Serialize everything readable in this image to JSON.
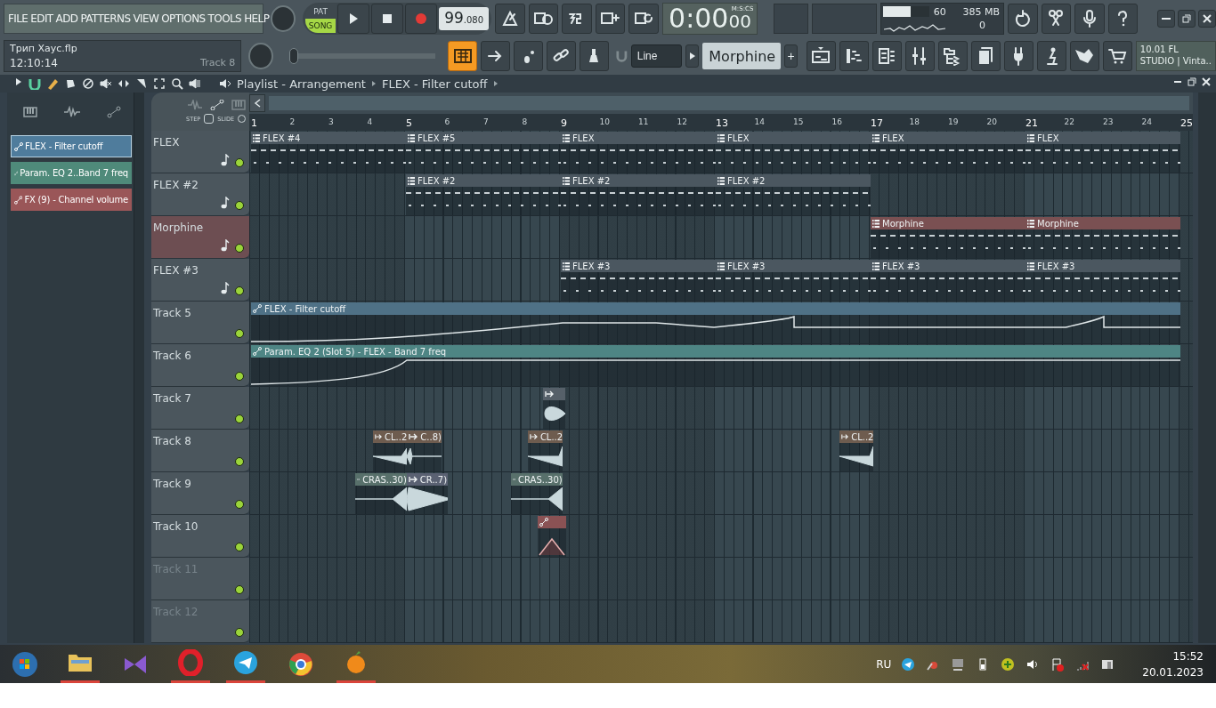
{
  "menu": [
    "FILE",
    "EDIT",
    "ADD",
    "PATTERNS",
    "VIEW",
    "OPTIONS",
    "TOOLS",
    "HELP"
  ],
  "song_info": {
    "file": "Трип Хаус.flp",
    "time": "12:10:14",
    "track": "Track 8"
  },
  "mode": [
    {
      "label": "PAT",
      "selected": false
    },
    {
      "label": "SONG",
      "selected": true
    }
  ],
  "tempo": {
    "whole": "99",
    "fraction": ".080"
  },
  "clock": {
    "value": "0:00",
    "hundredths": "00",
    "unit": "M:S:CS"
  },
  "monitor": {
    "cpu": "60",
    "level": 0.6,
    "memory": "385 MB",
    "polyphony": "0"
  },
  "song_position": {
    "level": 0
  },
  "snap": {
    "value": "Line"
  },
  "pattern": {
    "value": "Morphine",
    "add": "+"
  },
  "news": [
    "10.01  FL",
    "STUDIO | Vinta.."
  ],
  "playlist": {
    "title": "Playlist - Arrangement",
    "breadcrumb": "FLEX - Filter cutoff",
    "step": "STEP",
    "slide": "SLIDE"
  },
  "clip_sources": [
    {
      "label": "FLEX - Filter cutoff",
      "color": "#4f7c9c",
      "selected": true
    },
    {
      "label": "Param. EQ 2..Band 7 freq",
      "color": "#4f8a7a",
      "selected": false
    },
    {
      "label": "FX (9) - Channel volume",
      "color": "#9a5658",
      "selected": false
    }
  ],
  "bars": [
    "1",
    "2",
    "3",
    "4",
    "5",
    "6",
    "7",
    "8",
    "9",
    "10",
    "11",
    "12",
    "13",
    "14",
    "15",
    "16",
    "17",
    "18",
    "19",
    "20",
    "21",
    "22",
    "23",
    "24",
    "25"
  ],
  "tracks": [
    {
      "name": "FLEX",
      "kind": "instrument",
      "selected": false,
      "empty": false,
      "muted": false,
      "clips": [
        {
          "label": "FLEX #4",
          "kind": "pattern",
          "color": "#4b5760"
        },
        {
          "label": "FLEX #5",
          "kind": "pattern",
          "color": "#4b5760"
        },
        {
          "label": "FLEX",
          "kind": "pattern",
          "color": "#4b5760"
        },
        {
          "label": "FLEX",
          "kind": "pattern",
          "color": "#4b5760"
        },
        {
          "label": "FLEX",
          "kind": "pattern",
          "color": "#4b5760"
        },
        {
          "label": "FLEX",
          "kind": "pattern",
          "color": "#4b5760"
        }
      ]
    },
    {
      "name": "FLEX #2",
      "kind": "instrument",
      "selected": false,
      "empty": false,
      "muted": false,
      "clips": [
        {
          "label": "FLEX #2",
          "kind": "pattern",
          "color": "#4b5760"
        },
        {
          "label": "FLEX #2",
          "kind": "pattern",
          "color": "#4b5760"
        },
        {
          "label": "FLEX #2",
          "kind": "pattern",
          "color": "#4b5760"
        }
      ]
    },
    {
      "name": "Morphine",
      "kind": "instrument",
      "selected": true,
      "empty": false,
      "muted": false,
      "clips": [
        {
          "label": "Morphine",
          "kind": "pattern",
          "color": "#7a5052"
        },
        {
          "label": "Morphine",
          "kind": "pattern",
          "color": "#7a5052"
        }
      ]
    },
    {
      "name": "FLEX #3",
      "kind": "instrument",
      "selected": false,
      "empty": false,
      "muted": false,
      "clips": [
        {
          "label": "FLEX #3",
          "kind": "pattern",
          "color": "#4b5760"
        },
        {
          "label": "FLEX #3",
          "kind": "pattern",
          "color": "#4b5760"
        },
        {
          "label": "FLEX #3",
          "kind": "pattern",
          "color": "#4b5760"
        },
        {
          "label": "FLEX #3",
          "kind": "pattern",
          "color": "#4b5760"
        }
      ]
    },
    {
      "name": "Track 5",
      "kind": "plain",
      "selected": false,
      "empty": false,
      "muted": false,
      "clips": [
        {
          "label": "FLEX - Filter cutoff",
          "kind": "automation",
          "color": "#4f7186"
        }
      ]
    },
    {
      "name": "Track 6",
      "kind": "plain",
      "selected": false,
      "empty": false,
      "muted": false,
      "clips": [
        {
          "label": "Param. EQ 2 (Slot 5) - FLEX - Band 7 freq",
          "kind": "automation",
          "color": "#4e8584"
        }
      ]
    },
    {
      "name": "Track 7",
      "kind": "plain",
      "selected": false,
      "empty": false,
      "muted": false,
      "clips": [
        {
          "kind": "audio",
          "color": "#566069"
        }
      ]
    },
    {
      "name": "Track 8",
      "kind": "plain",
      "selected": false,
      "empty": false,
      "muted": false,
      "clips": [
        {
          "label": "CL..2",
          "kind": "audio",
          "color": "#6e5c4f"
        },
        {
          "label": "C..8)",
          "kind": "audio",
          "color": "#6e5c4f"
        },
        {
          "label": "CL..2",
          "kind": "audio",
          "color": "#6e5c4f"
        },
        {
          "label": "CL..2",
          "kind": "audio",
          "color": "#6e5c4f"
        }
      ]
    },
    {
      "name": "Track 9",
      "kind": "plain",
      "selected": false,
      "empty": false,
      "muted": false,
      "clips": [
        {
          "label": "CRAS..30)",
          "kind": "audio",
          "color": "#58706b"
        },
        {
          "label": "CR..7)",
          "kind": "audio",
          "color": "#5a6172"
        },
        {
          "label": "CRAS..30)",
          "kind": "audio",
          "color": "#58706b"
        }
      ]
    },
    {
      "name": "Track 10",
      "kind": "plain",
      "selected": false,
      "empty": false,
      "muted": false,
      "clips": [
        {
          "kind": "automation",
          "color": "#8a5254"
        }
      ]
    },
    {
      "name": "Track 11",
      "kind": "plain",
      "selected": false,
      "empty": true,
      "muted": false
    },
    {
      "name": "Track 12",
      "kind": "plain",
      "selected": false,
      "empty": true,
      "muted": false
    }
  ],
  "taskbar": {
    "language": "RU",
    "time": "15:52",
    "date": "20.01.2023"
  }
}
